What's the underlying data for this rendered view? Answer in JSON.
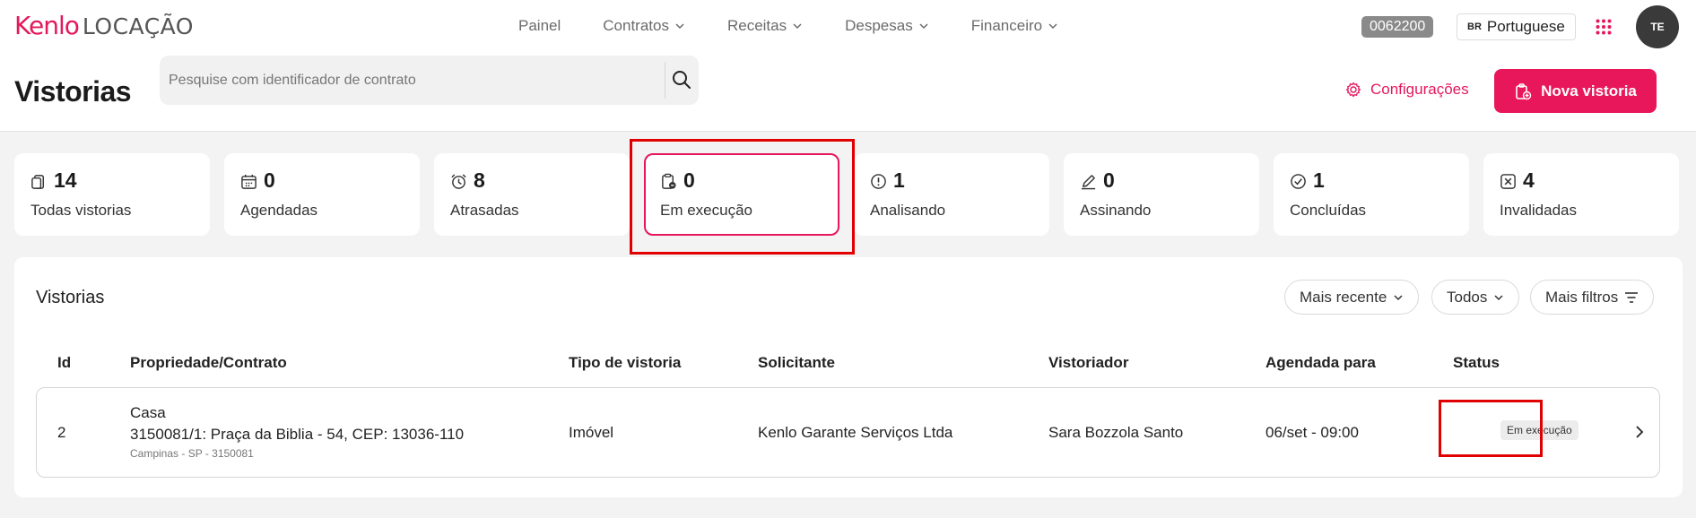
{
  "app": {
    "brand": "Kenlo",
    "product": "LOCAÇÃO"
  },
  "nav": {
    "items": [
      {
        "label": "Painel",
        "has_dropdown": false
      },
      {
        "label": "Contratos",
        "has_dropdown": true
      },
      {
        "label": "Receitas",
        "has_dropdown": true
      },
      {
        "label": "Despesas",
        "has_dropdown": true
      },
      {
        "label": "Financeiro",
        "has_dropdown": true
      }
    ]
  },
  "header_right": {
    "account_code": "0062200",
    "language_code": "BR",
    "language": "Portuguese",
    "apps_icon": "grid-dots-icon",
    "avatar_initials": "TE"
  },
  "page": {
    "title": "Vistorias",
    "search_placeholder": "Pesquise com identificador de contrato",
    "config_label": "Configurações",
    "new_button_label": "Nova vistoria"
  },
  "stats": [
    {
      "count": "14",
      "label": "Todas vistorias",
      "icon": "clipboard-icon"
    },
    {
      "count": "0",
      "label": "Agendadas",
      "icon": "calendar-icon"
    },
    {
      "count": "8",
      "label": "Atrasadas",
      "icon": "alarm-clock-icon"
    },
    {
      "count": "0",
      "label": "Em execução",
      "icon": "clipboard-progress-icon",
      "active": true
    },
    {
      "count": "1",
      "label": "Analisando",
      "icon": "alert-circle-icon"
    },
    {
      "count": "0",
      "label": "Assinando",
      "icon": "pen-icon"
    },
    {
      "count": "1",
      "label": "Concluídas",
      "icon": "check-circle-icon"
    },
    {
      "count": "4",
      "label": "Invalidadas",
      "icon": "x-square-icon"
    }
  ],
  "table": {
    "title": "Vistorias",
    "filters": {
      "sort": "Mais recente",
      "type": "Todos",
      "more": "Mais filtros"
    },
    "columns": [
      "Id",
      "Propriedade/Contrato",
      "Tipo de vistoria",
      "Solicitante",
      "Vistoriador",
      "Agendada para",
      "Status"
    ],
    "rows": [
      {
        "id": "2",
        "property_type": "Casa",
        "property_address": "3150081/1: Praça da Biblia - 54, CEP: 13036-110",
        "property_location": "Campinas - SP - 3150081",
        "inspection_type": "Imóvel",
        "requester": "Kenlo Garante Serviços Ltda",
        "inspector": "Sara Bozzola Santo",
        "scheduled_for": "06/set - 09:00",
        "status": "Em execução"
      }
    ]
  },
  "colors": {
    "accent": "#e8175c",
    "highlight_frame": "#e00000"
  }
}
